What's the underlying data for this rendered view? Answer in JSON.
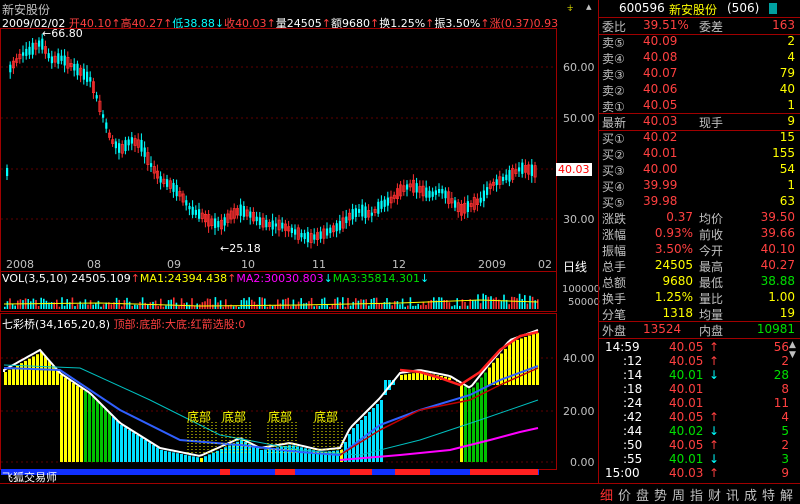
{
  "header": {
    "stock_name": "新安股份",
    "date": "2009/02/02",
    "open_label": "开",
    "open": "40.10",
    "high_label": "高",
    "high": "40.27",
    "low_label": "低",
    "low": "38.88",
    "close_label": "收",
    "close": "40.03",
    "volume_label": "量",
    "volume": "24505",
    "amount_label": "额",
    "amount": "9680",
    "turnover_label": "换",
    "turnover": "1.25%",
    "amplitude_label": "振",
    "amplitude": "3.50%",
    "change_label": "涨",
    "change": "(0.37)",
    "change_pct": "0.93"
  },
  "price_chart": {
    "y_ticks": [
      "60.00",
      "50.00",
      "40.00",
      "30.00"
    ],
    "x_ticks": [
      "2008",
      "08",
      "09",
      "10",
      "11",
      "12",
      "2009",
      "02"
    ],
    "high_marker": "66.80",
    "low_marker": "25.18",
    "current_price_tag": "40.03",
    "period_label": "日线",
    "colors": {
      "up": "#ff3030",
      "down": "#00ffff",
      "ma": "#ffffff"
    }
  },
  "volume_panel": {
    "name": "VOL(3,5,10)",
    "value": "24505.109",
    "ma1": "MA1:24394.438",
    "ma2": "MA2:30030.803",
    "ma3": "MA3:35814.301",
    "y_ticks": [
      "100000",
      "50000"
    ]
  },
  "indicator_panel": {
    "name": "七彩桥",
    "params": "(34,165,20,8)",
    "legend": "顶部:底部:大底:红箭选股:0",
    "y_ticks": [
      "40.00",
      "20.00",
      "0.00"
    ],
    "bottom_labels": [
      "底部",
      "底部",
      "底部",
      "底部"
    ],
    "footer": "飞狐交易师"
  },
  "quote": {
    "code": "600596",
    "name": "新安股份",
    "count": "(506)",
    "weibi_label": "委比",
    "weibi": "39.51%",
    "weicha_label": "委差",
    "weicha": "163",
    "sell": [
      {
        "label": "卖⑤",
        "price": "40.09",
        "vol": "2"
      },
      {
        "label": "卖④",
        "price": "40.08",
        "vol": "4"
      },
      {
        "label": "卖③",
        "price": "40.07",
        "vol": "79"
      },
      {
        "label": "卖②",
        "price": "40.06",
        "vol": "40"
      },
      {
        "label": "卖①",
        "price": "40.05",
        "vol": "1"
      }
    ],
    "last_label": "最新",
    "last": "40.03",
    "xianshou_label": "现手",
    "xianshou": "9",
    "buy": [
      {
        "label": "买①",
        "price": "40.02",
        "vol": "15"
      },
      {
        "label": "买②",
        "price": "40.01",
        "vol": "155"
      },
      {
        "label": "买③",
        "price": "40.00",
        "vol": "54"
      },
      {
        "label": "买④",
        "price": "39.99",
        "vol": "1"
      },
      {
        "label": "买⑤",
        "price": "39.98",
        "vol": "63"
      }
    ],
    "stats": [
      {
        "l1": "涨跌",
        "v1": "0.37",
        "l2": "均价",
        "v2": "39.50"
      },
      {
        "l1": "涨幅",
        "v1": "0.93%",
        "l2": "前收",
        "v2": "39.66"
      },
      {
        "l1": "振幅",
        "v1": "3.50%",
        "l2": "今开",
        "v2": "40.10"
      },
      {
        "l1": "总手",
        "v1": "24505",
        "l2": "最高",
        "v2": "40.27"
      },
      {
        "l1": "总额",
        "v1": "9680",
        "l2": "最低",
        "v2": "38.88"
      },
      {
        "l1": "换手",
        "v1": "1.25%",
        "l2": "量比",
        "v2": "1.00"
      },
      {
        "l1": "分笔",
        "v1": "1318",
        "l2": "均量",
        "v2": "19"
      }
    ],
    "waipan_label": "外盘",
    "waipan": "13524",
    "neipan_label": "内盘",
    "neipan": "10981",
    "ticks": [
      {
        "time": "14:59",
        "price": "40.05",
        "dir": "↑",
        "vol": "56"
      },
      {
        "time": ":12",
        "price": "40.05",
        "dir": "↑",
        "vol": "2"
      },
      {
        "time": ":14",
        "price": "40.01",
        "dir": "↓",
        "vol": "28"
      },
      {
        "time": ":18",
        "price": "40.01",
        "dir": "",
        "vol": "8"
      },
      {
        "time": ":24",
        "price": "40.01",
        "dir": "",
        "vol": "11"
      },
      {
        "time": ":42",
        "price": "40.05",
        "dir": "↑",
        "vol": "4"
      },
      {
        "time": ":44",
        "price": "40.02",
        "dir": "↓",
        "vol": "5"
      },
      {
        "time": ":50",
        "price": "40.05",
        "dir": "↑",
        "vol": "2"
      },
      {
        "time": ":55",
        "price": "40.01",
        "dir": "↓",
        "vol": "3"
      },
      {
        "time": "15:00",
        "price": "40.03",
        "dir": "↑",
        "vol": "9"
      }
    ]
  },
  "bottom_tabs": [
    "细",
    "价",
    "盘",
    "势",
    "周",
    "指",
    "财",
    "讯",
    "成",
    "特",
    "解"
  ]
}
